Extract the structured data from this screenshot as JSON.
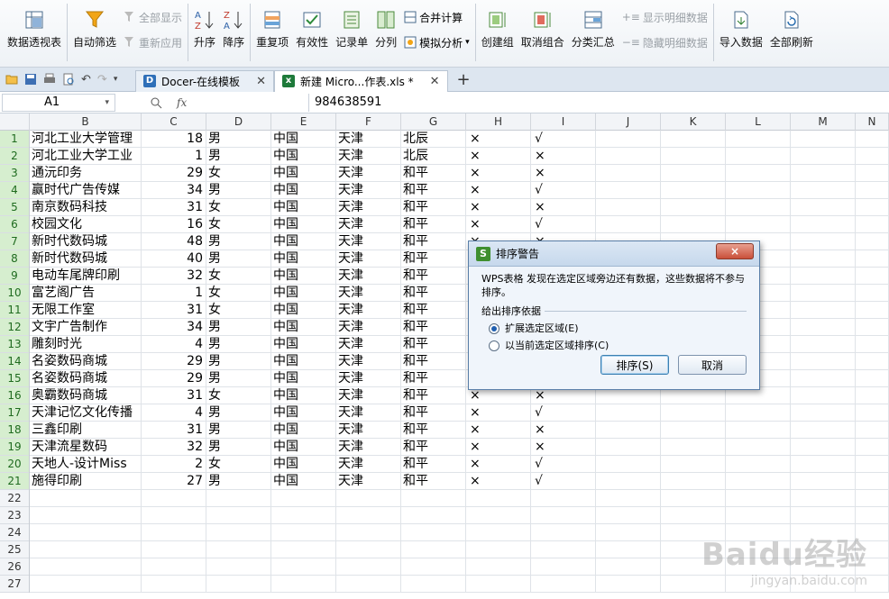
{
  "ribbon": {
    "pivot": "数据透视表",
    "autofilter": "自动筛选",
    "show_all": "全部显示",
    "reapply": "重新应用",
    "sort_asc": "升序",
    "sort_desc": "降序",
    "duplicates": "重复项",
    "validity": "有效性",
    "record_form": "记录单",
    "text_to_columns": "分列",
    "consolidate": "合并计算",
    "what_if": "模拟分析",
    "group": "创建组",
    "ungroup": "取消组合",
    "subtotal": "分类汇总",
    "show_detail": "显示明细数据",
    "hide_detail": "隐藏明细数据",
    "import_data": "导入数据",
    "refresh_all": "全部刷新"
  },
  "tabs": [
    {
      "label": "Docer-在线模板"
    },
    {
      "label": "新建 Micro...作表.xls *"
    }
  ],
  "formula": {
    "cell_ref": "A1",
    "fx": "fx",
    "value": "984638591"
  },
  "columns": [
    "B",
    "C",
    "D",
    "E",
    "F",
    "G",
    "H",
    "I",
    "J",
    "K",
    "L",
    "M",
    "N"
  ],
  "row_numbers": [
    "1",
    "2",
    "3",
    "4",
    "5",
    "6",
    "7",
    "8",
    "9",
    "10",
    "11",
    "12",
    "13",
    "14",
    "15",
    "16",
    "17",
    "18",
    "19",
    "20",
    "21",
    "22",
    "23",
    "24",
    "25",
    "26",
    "27"
  ],
  "rows": [
    [
      "河北工业大学管理",
      "18",
      "男",
      "中国",
      "天津",
      "北辰",
      "×",
      "√"
    ],
    [
      "河北工业大学工业",
      "1",
      "男",
      "中国",
      "天津",
      "北辰",
      "×",
      "×"
    ],
    [
      "通沅印务",
      "29",
      "女",
      "中国",
      "天津",
      "和平",
      "×",
      "×"
    ],
    [
      "赢时代广告传媒",
      "34",
      "男",
      "中国",
      "天津",
      "和平",
      "×",
      "√"
    ],
    [
      "南京数码科技",
      "31",
      "女",
      "中国",
      "天津",
      "和平",
      "×",
      "×"
    ],
    [
      "校园文化",
      "16",
      "女",
      "中国",
      "天津",
      "和平",
      "×",
      "√"
    ],
    [
      "新时代数码城",
      "48",
      "男",
      "中国",
      "天津",
      "和平",
      "×",
      "×"
    ],
    [
      "新时代数码城",
      "40",
      "男",
      "中国",
      "天津",
      "和平",
      "",
      ""
    ],
    [
      "电动车尾牌印刷",
      "32",
      "女",
      "中国",
      "天津",
      "和平",
      "",
      ""
    ],
    [
      "富艺阁广告",
      "1",
      "女",
      "中国",
      "天津",
      "和平",
      "",
      ""
    ],
    [
      "无限工作室",
      "31",
      "女",
      "中国",
      "天津",
      "和平",
      "",
      ""
    ],
    [
      "文宇广告制作",
      "34",
      "男",
      "中国",
      "天津",
      "和平",
      "",
      ""
    ],
    [
      "雕刻时光",
      "4",
      "男",
      "中国",
      "天津",
      "和平",
      "",
      ""
    ],
    [
      "名姿数码商城",
      "29",
      "男",
      "中国",
      "天津",
      "和平",
      "",
      ""
    ],
    [
      "名姿数码商城",
      "29",
      "男",
      "中国",
      "天津",
      "和平",
      "",
      ""
    ],
    [
      "奥霸数码商城",
      "31",
      "女",
      "中国",
      "天津",
      "和平",
      "×",
      "×"
    ],
    [
      "天津记忆文化传播",
      "4",
      "男",
      "中国",
      "天津",
      "和平",
      "×",
      "√"
    ],
    [
      "三鑫印刷",
      "31",
      "男",
      "中国",
      "天津",
      "和平",
      "×",
      "×"
    ],
    [
      "天津流星数码",
      "32",
      "男",
      "中国",
      "天津",
      "和平",
      "×",
      "×"
    ],
    [
      "天地人-设计Miss",
      "2",
      "女",
      "中国",
      "天津",
      "和平",
      "×",
      "√"
    ],
    [
      "施得印刷",
      "27",
      "男",
      "中国",
      "天津",
      "和平",
      "×",
      "√"
    ]
  ],
  "dialog": {
    "title": "排序警告",
    "close": "×",
    "message": "WPS表格 发现在选定区域旁边还有数据，这些数据将不参与排序。",
    "group_label": "给出排序依据",
    "option_expand": "扩展选定区域(E)",
    "option_current": "以当前选定区域排序(C)",
    "sort_button": "排序(S)",
    "cancel_button": "取消"
  },
  "watermark": {
    "brand": "Baidu经验",
    "url": "jingyan.baidu.com"
  }
}
